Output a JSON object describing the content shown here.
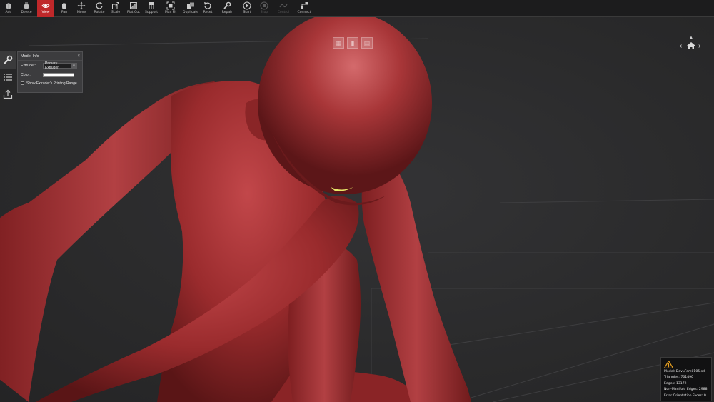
{
  "toolbar": {
    "items": [
      {
        "id": "add",
        "label": "Add",
        "icon": "add-cube-icon"
      },
      {
        "id": "delete",
        "label": "Delete",
        "icon": "delete-cube-icon"
      },
      {
        "id": "view",
        "label": "View",
        "icon": "eye-icon",
        "active": true
      },
      {
        "id": "pan",
        "label": "Pan",
        "icon": "hand-icon"
      },
      {
        "id": "move",
        "label": "Move",
        "icon": "move-arrows-icon"
      },
      {
        "id": "rotate",
        "label": "Rotate",
        "icon": "rotate-icon"
      },
      {
        "id": "scale",
        "label": "Scale",
        "icon": "scale-icon"
      },
      {
        "id": "flat-cut",
        "label": "Flat Cut",
        "icon": "flat-cut-icon"
      },
      {
        "id": "support",
        "label": "Support",
        "icon": "support-icon"
      },
      {
        "id": "max-fit",
        "label": "Max Fit",
        "icon": "max-fit-icon"
      },
      {
        "id": "duplicate",
        "label": "Duplicate",
        "icon": "duplicate-icon"
      },
      {
        "id": "reset",
        "label": "Reset",
        "icon": "reset-icon"
      },
      {
        "id": "repair",
        "label": "Repair",
        "icon": "wrench-icon"
      },
      {
        "id": "start",
        "label": "Start",
        "icon": "play-icon"
      },
      {
        "id": "stop",
        "label": "Stop",
        "icon": "stop-icon",
        "disabled": true
      },
      {
        "id": "control",
        "label": "Control",
        "icon": "control-icon",
        "disabled": true
      },
      {
        "id": "connect",
        "label": "Connect",
        "icon": "connect-icon"
      }
    ]
  },
  "sidebar": {
    "tabs": [
      {
        "id": "model-info",
        "icon": "wrench-icon",
        "active": true
      },
      {
        "id": "list",
        "icon": "list-icon"
      },
      {
        "id": "export",
        "icon": "export-icon"
      }
    ]
  },
  "model_info": {
    "title": "Model Info",
    "close": "×",
    "extruder_label": "Extruder:",
    "extruder_value": "Primary Extruder",
    "color_label": "Color:",
    "color_value": "#ffffff",
    "show_range_label": "Show Extruder's Printing Range"
  },
  "error_info": {
    "model": "Model: DavuFem0105.stl",
    "triangles": "Triangles: 701490",
    "edges": "Edges: 13172",
    "non_manifold": "Non-Manifold Edges: 2988",
    "orientation": "Error Orientation Faces: 0"
  },
  "colors": {
    "accent": "#c0282a",
    "model": "#9c2a2c",
    "toolbar_bg": "#1c1c1d",
    "viewport_bg": "#2a2a2b",
    "warning": "#e8a020"
  }
}
